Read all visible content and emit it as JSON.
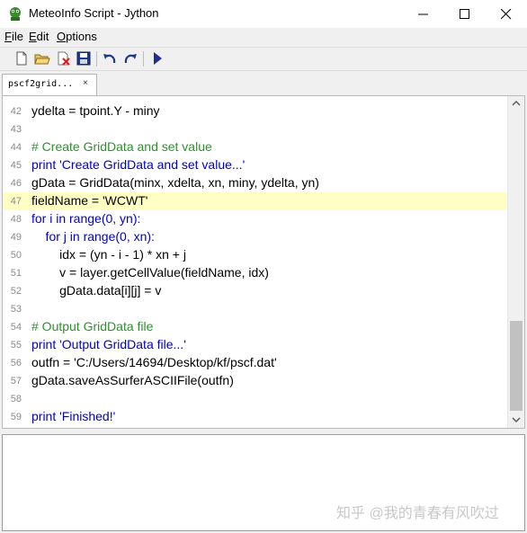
{
  "window": {
    "title": "MeteoInfo Script - Jython",
    "app_icon": "python-icon",
    "controls": [
      "minimize-icon",
      "maximize-icon",
      "close-icon"
    ]
  },
  "menu": {
    "items": [
      "File",
      "Edit",
      "Options"
    ]
  },
  "toolbar": {
    "buttons": [
      "new-file-icon",
      "open-folder-icon",
      "close-file-icon",
      "save-icon",
      "undo-icon",
      "redo-icon",
      "run-icon"
    ]
  },
  "tabs": [
    {
      "label": "pscf2grid...",
      "close": "×"
    }
  ],
  "editor": {
    "highlight_color": "#ffffc4",
    "lines": [
      {
        "num": "42",
        "text": "ydelta = tpoint.Y - miny"
      },
      {
        "num": "43",
        "text": ""
      },
      {
        "num": "44",
        "text": "# Create GridData and set value"
      },
      {
        "num": "45",
        "text": "print 'Create GridData and set value...'"
      },
      {
        "num": "46",
        "text": "gData = GridData(minx, xdelta, xn, miny, ydelta, yn)"
      },
      {
        "num": "47",
        "text": "fieldName = 'WCWT'"
      },
      {
        "num": "48",
        "text": "for i in range(0, yn):"
      },
      {
        "num": "49",
        "text": "    for j in range(0, xn):"
      },
      {
        "num": "50",
        "text": "        idx = (yn - i - 1) * xn + j"
      },
      {
        "num": "51",
        "text": "        v = layer.getCellValue(fieldName, idx)"
      },
      {
        "num": "52",
        "text": "        gData.data[i][j] = v"
      },
      {
        "num": "53",
        "text": ""
      },
      {
        "num": "54",
        "text": "# Output GridData file"
      },
      {
        "num": "55",
        "text": "print 'Output GridData file...'"
      },
      {
        "num": "56",
        "text": "outfn = 'C:/Users/14694/Desktop/kf/pscf.dat'"
      },
      {
        "num": "57",
        "text": "gData.saveAsSurferASCIIFile(outfn)"
      },
      {
        "num": "58",
        "text": ""
      },
      {
        "num": "59",
        "text": "print 'Finished!'"
      }
    ],
    "highlighted_line": "47"
  },
  "watermark": "知乎 @我的青春有风吹过"
}
